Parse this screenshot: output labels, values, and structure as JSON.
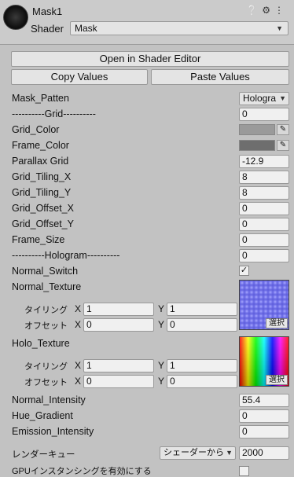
{
  "header": {
    "material_name": "Mask1",
    "icons": [
      "help-icon",
      "settings-icon",
      "overflow-menu-icon"
    ],
    "shader_label": "Shader",
    "shader_value": "Mask"
  },
  "buttons": {
    "open_editor": "Open in Shader Editor",
    "copy": "Copy Values",
    "paste": "Paste Values"
  },
  "properties": {
    "mask_patten": {
      "label": "Mask_Patten",
      "value": "Hologra"
    },
    "grid_header": {
      "label": "----------Grid----------",
      "value": "0"
    },
    "grid_color": {
      "label": "Grid_Color",
      "color": "#9a9a9a"
    },
    "frame_color": {
      "label": "Frame_Color",
      "color": "#6e6e6e"
    },
    "parallax_grid": {
      "label": "Parallax Grid",
      "value": "-12.9"
    },
    "grid_tiling_x": {
      "label": "Grid_Tiling_X",
      "value": "8"
    },
    "grid_tiling_y": {
      "label": "Grid_Tiling_Y",
      "value": "8"
    },
    "grid_offset_x": {
      "label": "Grid_Offset_X",
      "value": "0"
    },
    "grid_offset_y": {
      "label": "Grid_Offset_Y",
      "value": "0"
    },
    "frame_size": {
      "label": "Frame_Size",
      "value": "0"
    },
    "hologram_header": {
      "label": "----------Hologram----------",
      "value": "0"
    },
    "normal_switch": {
      "label": "Normal_Switch",
      "checked": "✓"
    },
    "normal_texture": {
      "label": "Normal_Texture",
      "tiling_label": "タイリング",
      "offset_label": "オフセット",
      "x": "X",
      "y": "Y",
      "tiling_x": "1",
      "tiling_y": "1",
      "offset_x": "0",
      "offset_y": "0",
      "select_label": "選択"
    },
    "holo_texture": {
      "label": "Holo_Texture",
      "tiling_label": "タイリング",
      "offset_label": "オフセット",
      "x": "X",
      "y": "Y",
      "tiling_x": "1",
      "tiling_y": "1",
      "offset_x": "0",
      "offset_y": "0",
      "select_label": "選択"
    },
    "normal_intensity": {
      "label": "Normal_Intensity",
      "value": "55.4"
    },
    "hue_gradient": {
      "label": "Hue_Gradient",
      "value": "0"
    },
    "emission_intensity": {
      "label": "Emission_Intensity",
      "value": "0"
    },
    "render_queue": {
      "label": "レンダーキュー",
      "mode": "シェーダーから",
      "value": "2000"
    },
    "gpu_instancing": {
      "label": "GPUインスタンシングを有効にする"
    }
  }
}
